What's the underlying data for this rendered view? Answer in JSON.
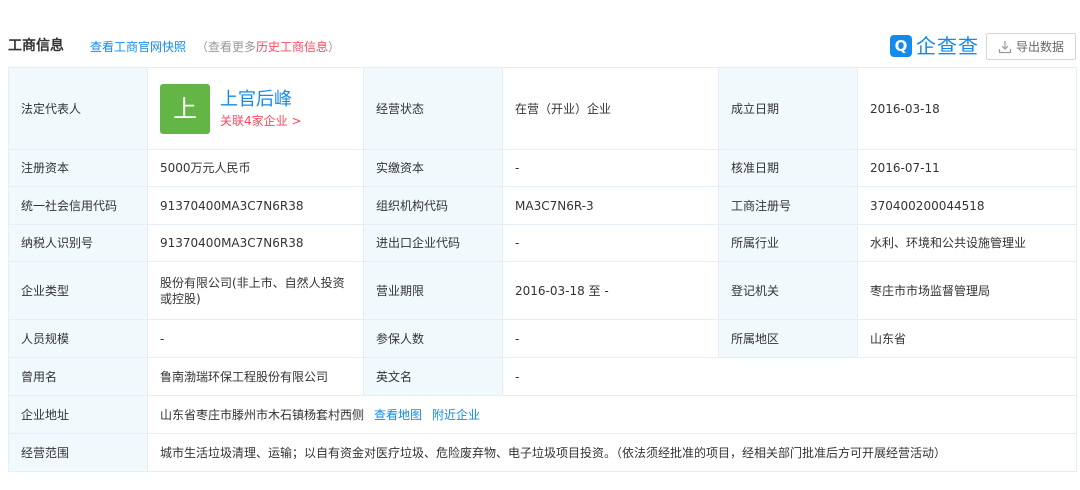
{
  "header": {
    "title": "工商信息",
    "snapshot_link": "查看工商官网快照",
    "note_prefix": "（查看更多",
    "history_link": "历史工商信息",
    "note_suffix": "）",
    "brand_icon": "Q",
    "brand_text": "企查查",
    "export_label": "导出数据"
  },
  "legal": {
    "avatar_char": "上",
    "name": "上官后峰",
    "assoc": "关联4家企业 >"
  },
  "labels": {
    "legal_rep": "法定代表人",
    "status": "经营状态",
    "est_date": "成立日期",
    "reg_capital": "注册资本",
    "paid_capital": "实缴资本",
    "approve_date": "核准日期",
    "credit_code": "统一社会信用代码",
    "org_code": "组织机构代码",
    "reg_no": "工商注册号",
    "taxpayer_id": "纳税人识别号",
    "ie_code": "进出口企业代码",
    "industry": "所属行业",
    "company_type": "企业类型",
    "term": "营业期限",
    "authority": "登记机关",
    "staff_size": "人员规模",
    "insured": "参保人数",
    "region": "所属地区",
    "former_name": "曾用名",
    "english_name": "英文名",
    "address": "企业地址",
    "scope": "经营范围"
  },
  "values": {
    "status": "在营（开业）企业",
    "est_date": "2016-03-18",
    "reg_capital": "5000万元人民币",
    "paid_capital": "-",
    "approve_date": "2016-07-11",
    "credit_code": "91370400MA3C7N6R38",
    "org_code": "MA3C7N6R-3",
    "reg_no": "370400200044518",
    "taxpayer_id": "91370400MA3C7N6R38",
    "ie_code": "-",
    "industry": "水利、环境和公共设施管理业",
    "company_type": "股份有限公司(非上市、自然人投资或控股)",
    "term": "2016-03-18 至 -",
    "authority": "枣庄市市场监督管理局",
    "staff_size": "-",
    "insured": "-",
    "region": "山东省",
    "former_name": "鲁南渤瑞环保工程股份有限公司",
    "english_name": "-",
    "address": "山东省枣庄市滕州市木石镇杨套村西侧",
    "map_link": "查看地图",
    "nearby_link": "附近企业",
    "scope": "城市生活垃圾清理、运输；以自有资金对医疗垃圾、危险废弃物、电子垃圾项目投资。（依法须经批准的项目，经相关部门批准后方可开展经营活动）"
  },
  "colors": {
    "accent": "#128bed",
    "highlight": "#fd485e",
    "label_bg": "#f2f9fc",
    "avatar_bg": "#63b545"
  },
  "icons": {
    "brand": "qichacha-logo-icon",
    "export": "download-icon"
  }
}
